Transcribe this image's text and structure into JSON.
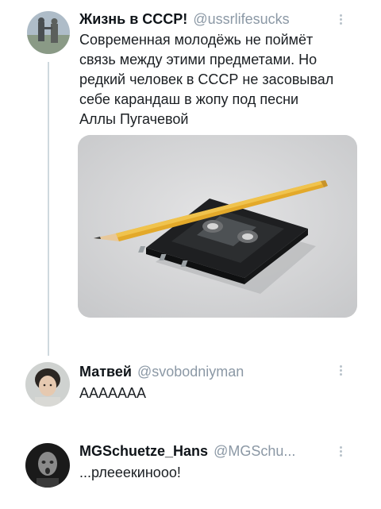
{
  "tweet": {
    "name": "Жизнь в СССР!",
    "handle": "@ussrlifesucks",
    "text_lines": [
      "Современная молодёжь не поймёт",
      "связь между этими предметами. Но",
      "редкий человек в СССР не засовывал",
      "себе карандаш в жопу под песни",
      "Аллы Пугачевой"
    ],
    "media_icon": "cassette-and-pencil-photo"
  },
  "replies": [
    {
      "name": "Матвей",
      "handle": "@svobodniyman",
      "text": "АААААAA"
    },
    {
      "name": "MGSchuetze_Hans",
      "handle": "@MGSchu...",
      "text": "...рлееекинооо!"
    }
  ],
  "colors": {
    "handle": "#8b98a5",
    "thread_line": "#cfd9de",
    "pencil": "#e3a92a"
  }
}
